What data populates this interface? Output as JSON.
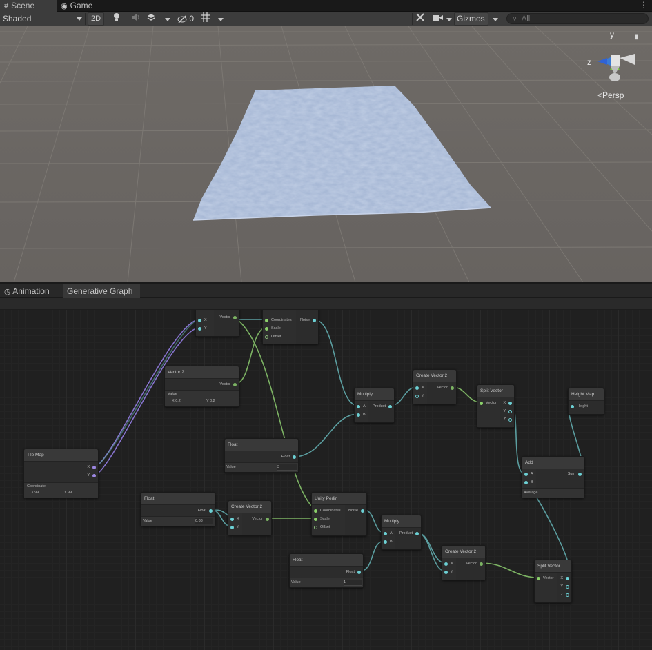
{
  "window_tabs": [
    {
      "label": "Scene",
      "icon": "grid-icon"
    },
    {
      "label": "Game",
      "icon": "gamepad-icon"
    }
  ],
  "toolbar": {
    "shading_mode": "Shaded",
    "two_d_label": "2D",
    "hidden_count": "0",
    "gizmos_label": "Gizmos",
    "search_placeholder": "All"
  },
  "scene": {
    "projection_label": "Persp",
    "gizmo_axes": {
      "y": "y",
      "z": "z"
    }
  },
  "panel_tabs": [
    {
      "label": "Animation",
      "icon": "clock-icon",
      "active": false
    },
    {
      "label": "Generative Graph",
      "active": true
    }
  ],
  "colors": {
    "vector_port": "#6cd0d4",
    "float_port": "#8bd06a",
    "tilemap_port": "#9b86e0",
    "edge_teal": "#5b9ea0",
    "edge_green": "#7cb363",
    "edge_purple": "#8874d0"
  },
  "nodes": {
    "top_vector_partial": {
      "inputs": [
        "X",
        "Y"
      ],
      "output": "Vector"
    },
    "top_perlin_partial": {
      "inputs": [
        "Coordinates",
        "Scale",
        "Offset"
      ],
      "output": "Noise"
    },
    "vector2": {
      "title": "Vector 2",
      "output": "Vector",
      "field_label": "Value",
      "x": "X  0.2",
      "y": "Y  0.2"
    },
    "tile_map": {
      "title": "Tile Map",
      "outputs": [
        "X",
        "Y"
      ],
      "field_label": "Coordinate",
      "x": "X  99",
      "y": "Y  99"
    },
    "float_a": {
      "title": "Float",
      "output": "Float",
      "field_label": "Value",
      "value": "3"
    },
    "float_b": {
      "title": "Float",
      "output": "Float",
      "field_label": "Value",
      "value": "0.88"
    },
    "float_c": {
      "title": "Float",
      "output": "Float",
      "field_label": "Value",
      "value": "1"
    },
    "multiply_a": {
      "title": "Multiply",
      "inputs": [
        "A",
        "B"
      ],
      "output": "Product"
    },
    "multiply_b": {
      "title": "Multiply",
      "inputs": [
        "A",
        "B"
      ],
      "output": "Product"
    },
    "create_vector_a": {
      "title": "Create Vector 2",
      "inputs": [
        "X",
        "Y"
      ],
      "output": "Vector"
    },
    "create_vector_b": {
      "title": "Create Vector 2",
      "inputs": [
        "X",
        "Y"
      ],
      "output": "Vector"
    },
    "create_vector_c": {
      "title": "Create Vector 2",
      "inputs": [
        "X",
        "Y"
      ],
      "output": "Vector"
    },
    "split_vector_a": {
      "title": "Split Vector",
      "input": "Vector",
      "outputs": [
        "X",
        "Y",
        "Z"
      ]
    },
    "split_vector_b": {
      "title": "Split Vector",
      "input": "Vector",
      "outputs": [
        "X",
        "Y",
        "Z"
      ]
    },
    "add": {
      "title": "Add",
      "inputs": [
        "A",
        "B"
      ],
      "output": "Sum",
      "field_label": "Average"
    },
    "height_map": {
      "title": "Height Map",
      "input": "Height"
    },
    "unity_perlin": {
      "title": "Unity Perlin",
      "inputs": [
        "Coordinates",
        "Scale",
        "Offset"
      ],
      "output": "Noise"
    }
  }
}
